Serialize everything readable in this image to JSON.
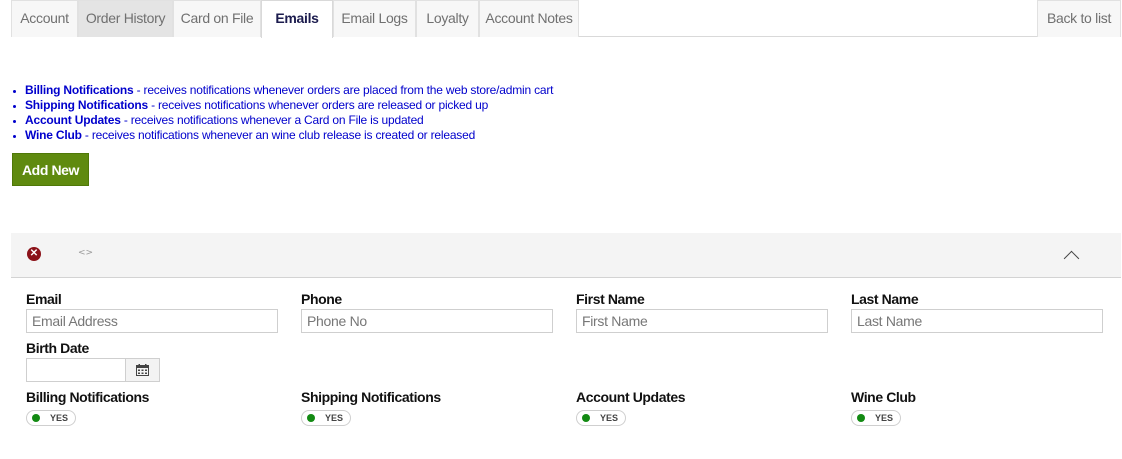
{
  "tabs": [
    {
      "label": "Account"
    },
    {
      "label": "Order History"
    },
    {
      "label": "Card on File"
    },
    {
      "label": "Emails"
    },
    {
      "label": "Email Logs"
    },
    {
      "label": "Loyalty"
    },
    {
      "label": "Account Notes"
    }
  ],
  "active_tab": "Emails",
  "back_link": "Back to list",
  "legend": [
    {
      "title": "Billing Notifications",
      "desc": " - receives notifications whenever orders are placed from the web store/admin cart"
    },
    {
      "title": "Shipping Notifications",
      "desc": " - receives notifications whenever orders are released or picked up"
    },
    {
      "title": "Account Updates",
      "desc": " - receives notifications whenever a Card on File is updated"
    },
    {
      "title": "Wine Club",
      "desc": " - receives notifications whenever an wine club release is created or released"
    }
  ],
  "add_button": "Add New",
  "panel": {
    "delete_icon": "remove-circle-icon",
    "code_icon": "code-icon",
    "code_glyph": "<>",
    "collapse_icon": "chevron-up-icon"
  },
  "form": {
    "email": {
      "label": "Email",
      "placeholder": "Email Address",
      "value": ""
    },
    "phone": {
      "label": "Phone",
      "placeholder": "Phone No",
      "value": ""
    },
    "first_name": {
      "label": "First Name",
      "placeholder": "First Name",
      "value": ""
    },
    "last_name": {
      "label": "Last Name",
      "placeholder": "Last Name",
      "value": ""
    },
    "birth_date": {
      "label": "Birth Date",
      "value": "",
      "icon": "calendar-icon"
    }
  },
  "toggles": [
    {
      "label": "Billing Notifications",
      "state": "YES"
    },
    {
      "label": "Shipping Notifications",
      "state": "YES"
    },
    {
      "label": "Account Updates",
      "state": "YES"
    },
    {
      "label": "Wine Club",
      "state": "YES"
    }
  ],
  "colors": {
    "legend_text": "#0000cc",
    "add_button": "#5f8a0f",
    "delete_icon": "#8b1219",
    "toggle_on": "#138a13",
    "active_tab_text": "#1c1c4e"
  }
}
